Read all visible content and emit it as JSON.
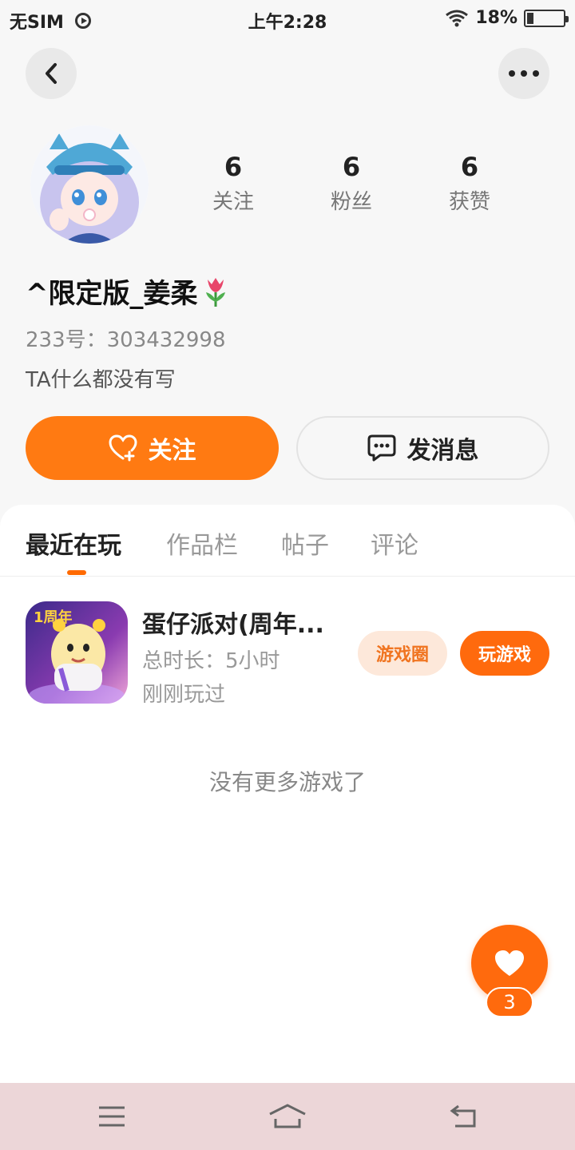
{
  "status_bar": {
    "carrier": "无SIM",
    "time": "上午2:28",
    "battery": "18%",
    "battery_level": 0.18
  },
  "nav": {
    "back_icon": "chevron-left-icon",
    "more_icon": "more-dots-icon"
  },
  "profile": {
    "stats": [
      {
        "value": "6",
        "label": "关注"
      },
      {
        "value": "6",
        "label": "粉丝"
      },
      {
        "value": "6",
        "label": "获赞"
      }
    ],
    "username": "^限定版_姜柔",
    "uid": "233号：303432998",
    "bio": "TA什么都没有写",
    "follow_label": "关注",
    "message_label": "发消息"
  },
  "tabs": [
    {
      "label": "最近在玩",
      "active": true
    },
    {
      "label": "作品栏",
      "active": false
    },
    {
      "label": "帖子",
      "active": false
    },
    {
      "label": "评论",
      "active": false
    }
  ],
  "games": [
    {
      "title": "蛋仔派对(周年...",
      "playtime": "总时长：5小时",
      "last_played": "刚刚玩过",
      "circle_label": "游戏圈",
      "play_label": "玩游戏",
      "icon_badge": "1周年"
    }
  ],
  "empty_text": "没有更多游戏了",
  "like": {
    "count": "3"
  },
  "colors": {
    "accent": "#ff7a12",
    "background": "#f7f7f7",
    "nav_bar": "#ecd6d8"
  }
}
